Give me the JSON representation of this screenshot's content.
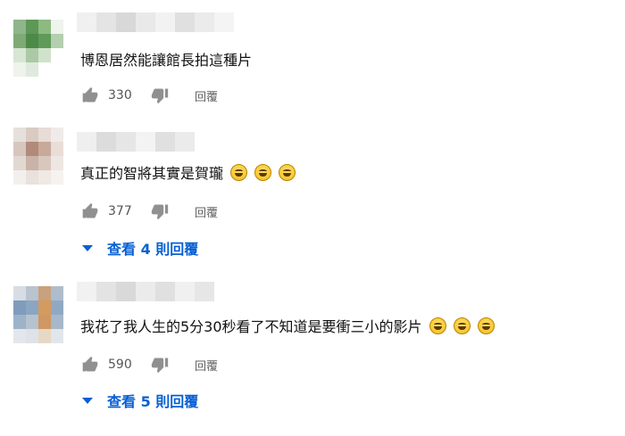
{
  "comments": [
    {
      "text": "博恩居然能讓館長拍這種片",
      "likes": "330",
      "reply_label": "回覆",
      "emoji_count": 0,
      "avatar_colors": [
        "#8fb58a",
        "#5d9856",
        "#8db982",
        "#eef3ec",
        "#7eaa75",
        "#4e8a47",
        "#5f9a58",
        "#b4cfae",
        "#d6e6d3",
        "#aac9a4",
        "#d0e2cc",
        "#ffffff",
        "#eef3ec",
        "#dfe9dd",
        "#ffffff",
        "#ffffff"
      ],
      "author_colors": [
        "#f0f0f0",
        "#e4e4e4",
        "#d8d8d8",
        "#e9e9e9",
        "#f2f2f2",
        "#e0e0e0",
        "#ebebeb",
        "#f4f4f4"
      ]
    },
    {
      "text": "真正的智將其實是賀瓏",
      "likes": "377",
      "reply_label": "回覆",
      "emoji_count": 3,
      "avatar_colors": [
        "#e6e0dc",
        "#d9cbc4",
        "#e7dcd6",
        "#f0ebe8",
        "#d7c6bd",
        "#b28a7a",
        "#c9a99a",
        "#e8ddd7",
        "#e2d8d2",
        "#c9b3a8",
        "#d9c6bd",
        "#eee6e2",
        "#f3efec",
        "#e9e1dc",
        "#efe8e4",
        "#f6f2f0"
      ],
      "author_colors": [
        "#efefef",
        "#dcdcdc",
        "#e6e6e6",
        "#f3f3f3",
        "#e0e0e0",
        "#ebebeb"
      ],
      "view_replies": "查看 4 則回覆"
    },
    {
      "text": "我花了我人生的5分30秒看了不知道是要衝三小的影片",
      "likes": "590",
      "reply_label": "回覆",
      "emoji_count": 3,
      "avatar_colors": [
        "#d7dde3",
        "#b8c4cf",
        "#c9a17c",
        "#aebdcb",
        "#7f9cbc",
        "#8ba6c2",
        "#d59a5f",
        "#90a9c3",
        "#9db3c8",
        "#b5c2cf",
        "#d09762",
        "#a6b8c9",
        "#e3e7eb",
        "#dfe3e7",
        "#e7d7c5",
        "#e2e6ea"
      ],
      "author_colors": [
        "#f1f1f1",
        "#e3e3e3",
        "#d9d9d9",
        "#ebebeb",
        "#e0e0e0",
        "#f0f0f0",
        "#e6e6e6"
      ],
      "view_replies": "查看 5 則回覆"
    }
  ]
}
